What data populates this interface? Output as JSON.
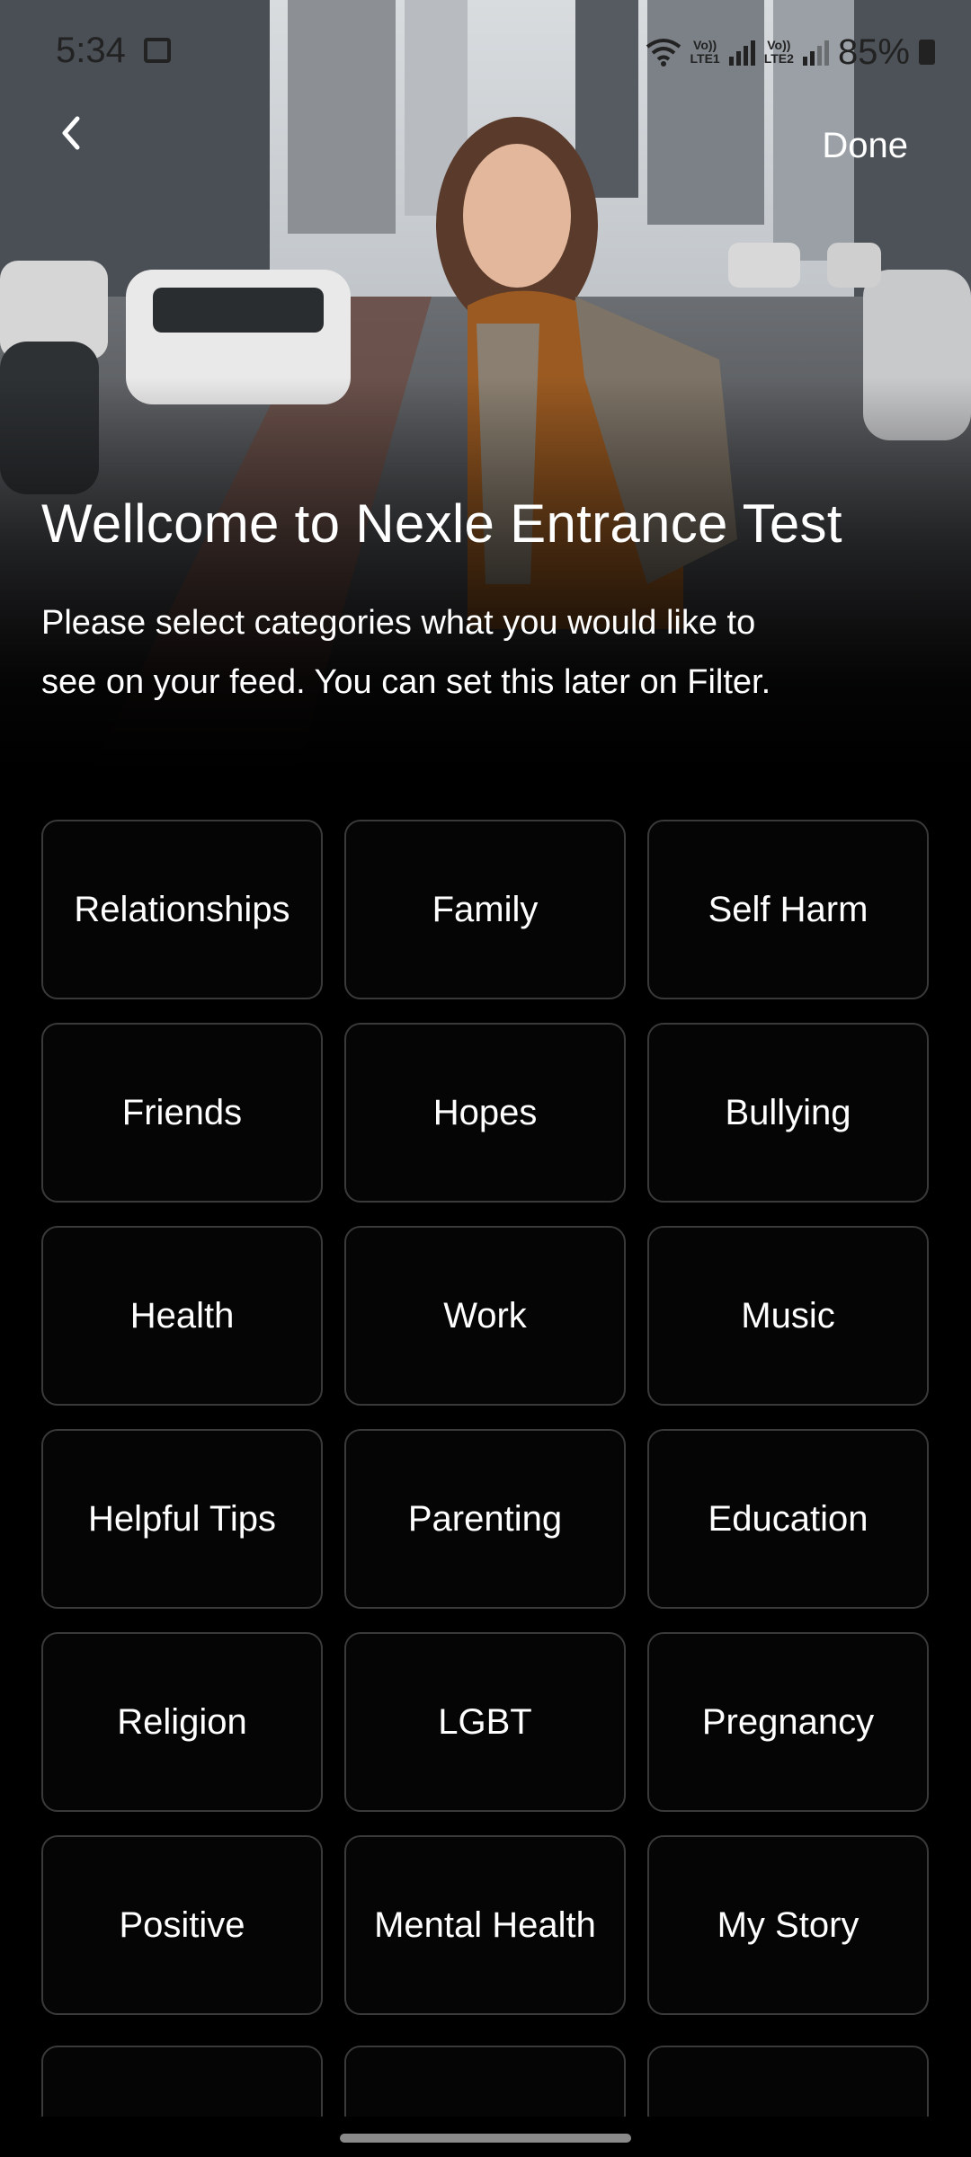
{
  "status_bar": {
    "time": "5:34",
    "lte1": "Vo))\nLTE1",
    "lte2": "Vo))\nLTE2",
    "battery": "85%"
  },
  "header": {
    "done_label": "Done"
  },
  "welcome": {
    "title": "Wellcome to Nexle Entrance Test",
    "description": "Please select categories what you would like to see on your feed. You can set this later on Filter."
  },
  "categories": [
    "Relationships",
    "Family",
    "Self Harm",
    "Friends",
    "Hopes",
    "Bullying",
    "Health",
    "Work",
    "Music",
    "Helpful Tips",
    "Parenting",
    "Education",
    "Religion",
    "LGBT",
    "Pregnancy",
    "Positive",
    "Mental Health",
    "My Story"
  ],
  "colors": {
    "background": "#000000",
    "tile_border": "#3a3a3a",
    "text": "#ffffff"
  }
}
